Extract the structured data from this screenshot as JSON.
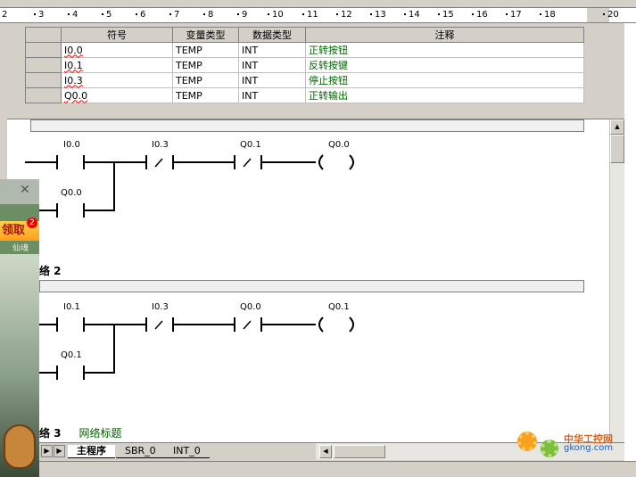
{
  "ruler": {
    "ticks": [
      "2",
      "3",
      "4",
      "5",
      "6",
      "7",
      "8",
      "9",
      "10",
      "11",
      "12",
      "13",
      "14",
      "15",
      "16",
      "17",
      "18",
      "20"
    ]
  },
  "var_table": {
    "headers": [
      "符号",
      "变量类型",
      "数据类型",
      "注释"
    ],
    "rows": [
      {
        "symbol": "I0.0",
        "var_type": "TEMP",
        "data_type": "INT",
        "comment": "正转按钮"
      },
      {
        "symbol": "I0.1",
        "var_type": "TEMP",
        "data_type": "INT",
        "comment": "反转按键"
      },
      {
        "symbol": "I0.3",
        "var_type": "TEMP",
        "data_type": "INT",
        "comment": "停止按钮"
      },
      {
        "symbol": "Q0.0",
        "var_type": "TEMP",
        "data_type": "INT",
        "comment": "正转输出"
      }
    ]
  },
  "network1": {
    "contact1": "I0.0",
    "contact2": "I0.3",
    "contact3": "Q0.1",
    "coil": "Q0.0",
    "parallel": "Q0.0"
  },
  "network2": {
    "title": "络 2",
    "contact1": "I0.1",
    "contact2": "I0.3",
    "contact3": "Q0.0",
    "coil": "Q0.1",
    "parallel": "Q0.1"
  },
  "network3": {
    "title": "络 3",
    "subtitle": "网络标题"
  },
  "tabs": [
    "主程序",
    "SBR_0",
    "INT_0"
  ],
  "popup": {
    "claim": "领取",
    "badge": "2",
    "sub": "仙魂",
    "close": "✕"
  },
  "watermark": {
    "line1": "中华工控网",
    "line2": "gkong.com"
  }
}
